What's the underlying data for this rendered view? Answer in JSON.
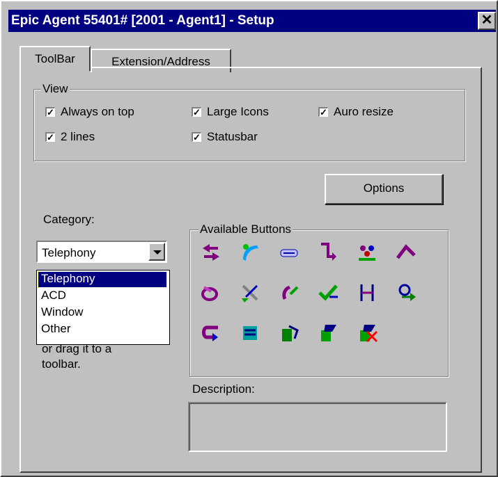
{
  "window": {
    "title": "Epic Agent 55401# [2001 - Agent1] - Setup",
    "close_glyph": "✕"
  },
  "tabs": [
    {
      "label": "ToolBar",
      "selected": true
    },
    {
      "label": "Extension/Address",
      "selected": false
    }
  ],
  "view": {
    "label": "View",
    "options": [
      {
        "label": "Always on top",
        "checked": true
      },
      {
        "label": "Large Icons",
        "checked": true
      },
      {
        "label": "Auro resize",
        "checked": true
      },
      {
        "label": "2 lines",
        "checked": true
      },
      {
        "label": "Statusbar",
        "checked": true
      }
    ]
  },
  "options_button": "Options",
  "category": {
    "label": "Category:",
    "selected": "Telephony",
    "options": [
      "Telephony",
      "ACD",
      "Window",
      "Other"
    ],
    "hint_visible": [
      "or drag it to a",
      "toolbar."
    ]
  },
  "available_buttons": {
    "label": "Available Buttons",
    "icons": [
      "transfer-arrows-icon",
      "handset-pickup-icon",
      "hold-icon",
      "redirect-icon",
      "conference-icon",
      "forward-arrow-icon",
      "paperclip-icon",
      "drop-call-icon",
      "callback-icon",
      "check-forward-icon",
      "split-icon",
      "agent-arrow-icon",
      "return-call-icon",
      "phone-pickup-icon",
      "phone-transfer-icon",
      "phone-green-icon",
      "phone-disconnect-icon"
    ]
  },
  "description": {
    "label": "Description:",
    "value": ""
  },
  "colors": {
    "title_bar": "#000080",
    "face": "#c0c0c0",
    "selection": "#000080"
  }
}
